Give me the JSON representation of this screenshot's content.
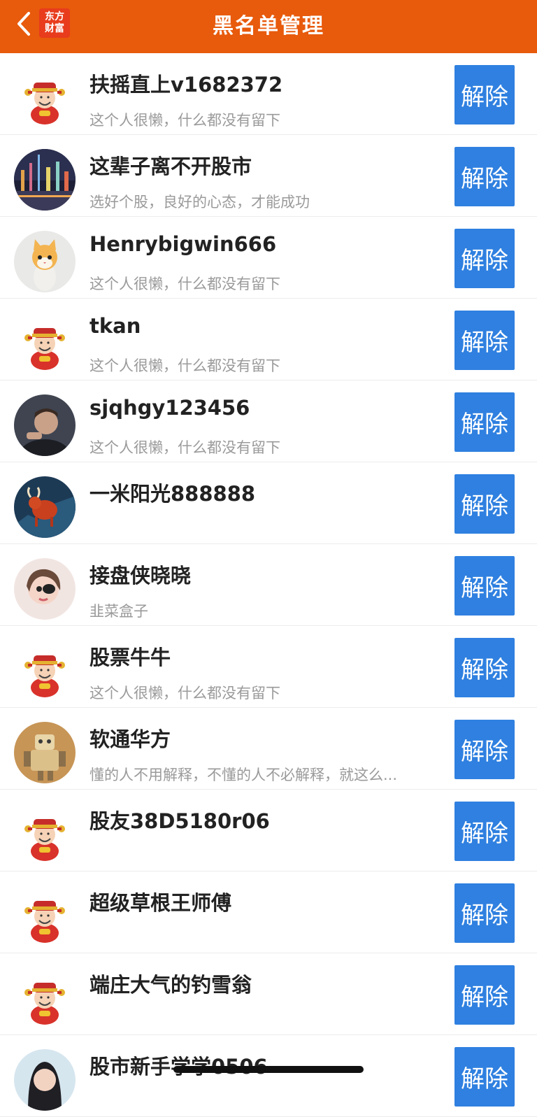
{
  "header": {
    "title": "黑名单管理",
    "logo_line1": "东方",
    "logo_line2": "财富",
    "back_icon": "chevron-left-icon"
  },
  "colors": {
    "header_bg": "#e85a0c",
    "button_bg": "#2f80e0",
    "name": "#222222",
    "signature": "#9a9a9a"
  },
  "unblock_label": "解除",
  "rows": [
    {
      "name": "扶摇直上v1682372",
      "signature": "这个人很懒，什么都没有留下",
      "avatar": "fortune-god-avatar"
    },
    {
      "name": "这辈子离不开股市",
      "signature": "选好个股，良好的心态，才能成功",
      "avatar": "city-night-avatar"
    },
    {
      "name": "Henrybigwin666",
      "signature": "这个人很懒，什么都没有留下",
      "avatar": "cat-avatar"
    },
    {
      "name": "tkan",
      "signature": "这个人很懒，什么都没有留下",
      "avatar": "fortune-god-avatar"
    },
    {
      "name": "sjqhgy123456",
      "signature": "这个人很懒，什么都没有留下",
      "avatar": "man-portrait-avatar"
    },
    {
      "name": "一米阳光888888",
      "signature": "",
      "avatar": "bull-avatar"
    },
    {
      "name": "接盘侠晓晓",
      "signature": "韭菜盒子",
      "avatar": "girl-avatar"
    },
    {
      "name": "股票牛牛",
      "signature": "这个人很懒，什么都没有留下",
      "avatar": "fortune-god-avatar"
    },
    {
      "name": "软通华方",
      "signature": "懂的人不用解释，不懂的人不必解释，就这么...",
      "avatar": "robot-toy-avatar"
    },
    {
      "name": "股友38D5180r06",
      "signature": "",
      "avatar": "fortune-god-avatar"
    },
    {
      "name": "超级草根王师傅",
      "signature": "",
      "avatar": "fortune-god-avatar"
    },
    {
      "name": "端庄大气的钓雪翁",
      "signature": "",
      "avatar": "fortune-god-avatar"
    },
    {
      "name": "股市新手学学0506",
      "signature": "",
      "avatar": "woman-portrait-avatar"
    }
  ]
}
